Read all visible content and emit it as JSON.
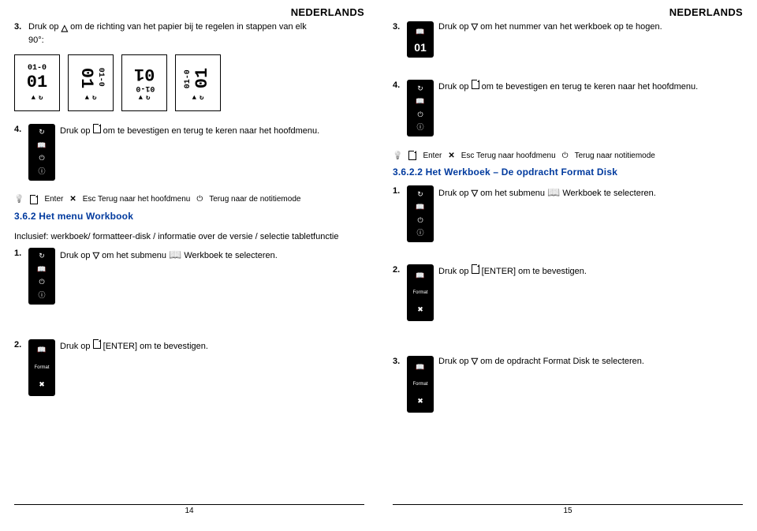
{
  "left": {
    "header": "NEDERLANDS",
    "steps": {
      "s3_num": "3.",
      "s3_a": "Druk op ",
      "s3_b": " om de richting van het papier bij te regelen in stappen van elk",
      "s3_deg": "90°:",
      "orient": [
        "01-0",
        "01-0",
        "01-0",
        "01-0"
      ],
      "orient_big": "01",
      "s4_num": "4.",
      "s4_a": "Druk op ",
      "s4_b": " om te bevestigen en terug te keren naar het hoofdmenu."
    },
    "hint": {
      "enter": "Enter",
      "esc": "Esc Terug naar het hoofdmenu",
      "pwr": "Terug naar de notitiemode"
    },
    "section": "3.6.2 Het menu Workbook",
    "inclusive": "Inclusief: werkboek/ formatteer-disk / informatie over de versie / selectie tabletfunctie",
    "lower": {
      "s1_num": "1.",
      "s1_a": "Druk op ",
      "s1_b": " om het submenu ",
      "s1_c": " Werkboek te selecteren.",
      "s2_num": "2.",
      "s2_a": "Druk op ",
      "s2_b": " [ENTER] om te bevestigen."
    },
    "pagenum": "14"
  },
  "right": {
    "header": "NEDERLANDS",
    "steps": {
      "s3_num": "3.",
      "s3_a": "Druk op ",
      "s3_b": " om het nummer van het werkboek op te hogen.",
      "s4_num": "4.",
      "s4_a": "Druk op ",
      "s4_b": " om te bevestigen en terug te keren naar het hoofdmenu."
    },
    "hint": {
      "enter": "Enter",
      "esc": "Esc Terug naar hoofdmenu",
      "pwr": "Terug naar notitiemode"
    },
    "section": "3.6.2.2 Het Werkboek – De opdracht Format Disk",
    "lower": {
      "s1_num": "1.",
      "s1_a": "Druk op ",
      "s1_b": " om het submenu ",
      "s1_c": " Werkboek te selecteren.",
      "s2_num": "2.",
      "s2_a": "Druk op ",
      "s2_b": " [ENTER] om te bevestigen.",
      "s3l_num": "3.",
      "s3l_a": "Druk op ",
      "s3l_b": " om de opdracht Format Disk te selecteren."
    },
    "pagenum": "15"
  }
}
